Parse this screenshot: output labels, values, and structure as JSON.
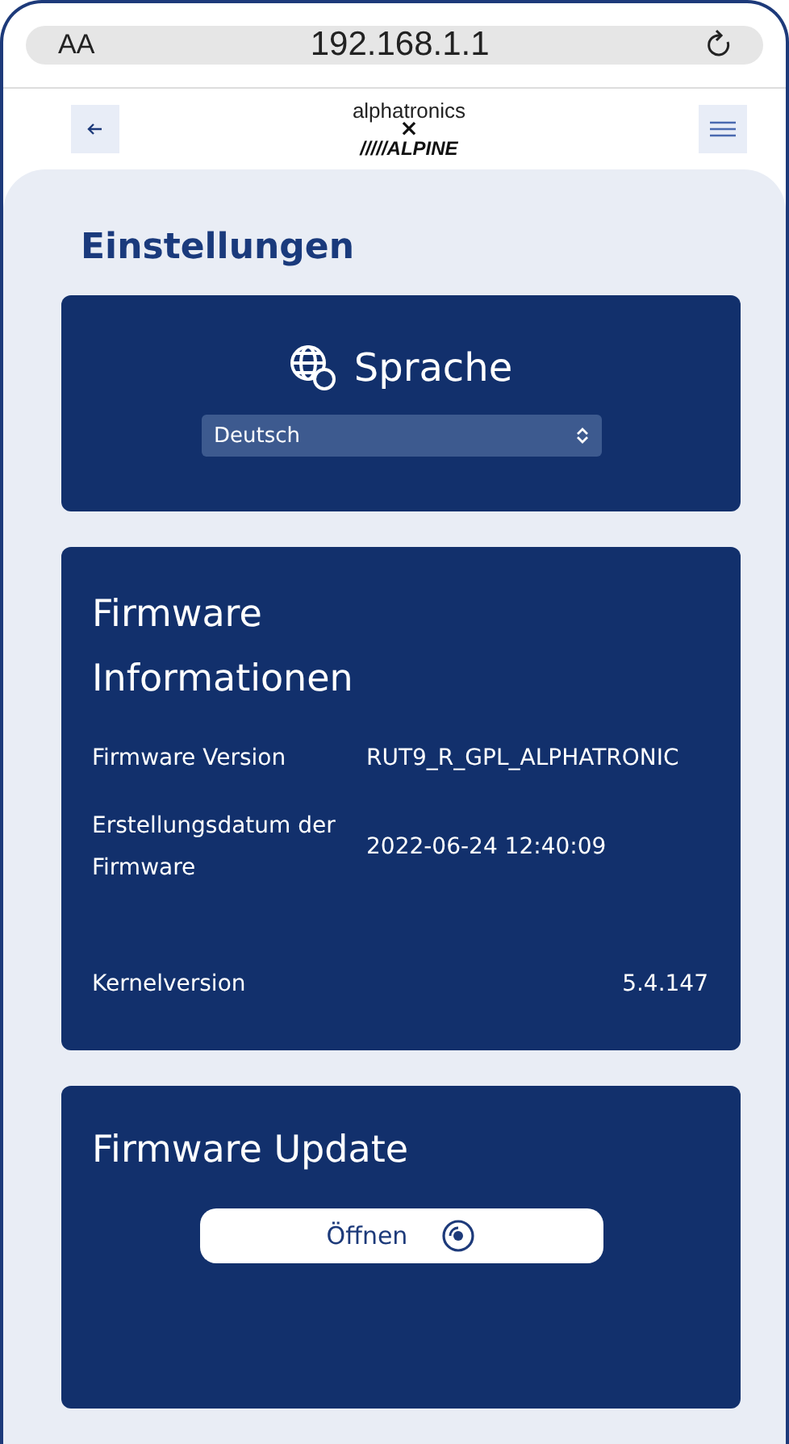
{
  "address_bar": {
    "text_size_button": "AA",
    "url": "192.168.1.1"
  },
  "header": {
    "logo_top": "alphatronics",
    "logo_x": "×",
    "logo_bottom": "/////ALPINE"
  },
  "settings": {
    "title": "Einstellungen",
    "language_card": {
      "title": "Sprache",
      "select_value": "Deutsch"
    },
    "firmware_info_card": {
      "title": "Firmware Informationen",
      "rows": [
        {
          "label": "Firmware Version",
          "value": "RUT9_R_GPL_ALPHATRONIC"
        },
        {
          "label": "Erstellungsdatum der Firmware",
          "value": "2022-06-24 12:40:09"
        },
        {
          "label": "Kernelversion",
          "value": "5.4.147"
        }
      ]
    },
    "firmware_update_card": {
      "title": "Firmware Update",
      "button": "Öffnen"
    }
  }
}
